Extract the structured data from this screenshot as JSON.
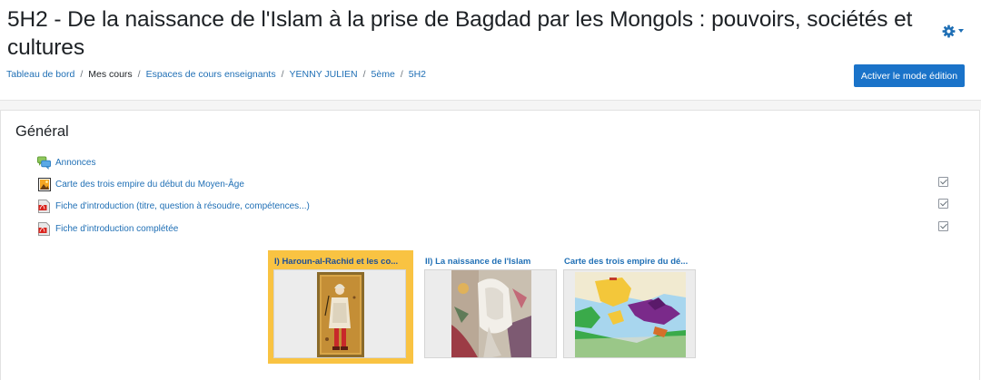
{
  "page": {
    "title": "5H2 - De la naissance de l'Islam à la prise de Bagdad par les Mongols : pouvoirs, sociétés et cultures",
    "accent_color": "#1a73c9",
    "highlight_color": "#f9c342"
  },
  "header_actions": {
    "settings_icon": "gear-icon",
    "edit_mode_label": "Activer le mode édition"
  },
  "breadcrumb": [
    {
      "label": "Tableau de bord"
    },
    {
      "label": "Mes cours"
    },
    {
      "label": "Espaces de cours enseignants"
    },
    {
      "label": "YENNY JULIEN"
    },
    {
      "label": "5ème"
    },
    {
      "label": "5H2"
    }
  ],
  "section": {
    "title": "Général",
    "activities": [
      {
        "label": "Annonces",
        "icon": "forum-icon",
        "completion": false
      },
      {
        "label": "Carte des trois empire du début du Moyen-Âge",
        "icon": "image-file-icon",
        "completion": true
      },
      {
        "label": "Fiche d'introduction (titre, question à résoudre, compétences...)",
        "icon": "pdf-file-icon",
        "completion": true
      },
      {
        "label": "Fiche d'introduction complétée",
        "icon": "pdf-file-icon",
        "completion": true
      }
    ]
  },
  "tiles": [
    {
      "label": "I) Haroun-al-Rachid et les co...",
      "thumbnail": "persian-miniature-thumbnail",
      "active": true
    },
    {
      "label": "II) La naissance de l'Islam",
      "thumbnail": "islamic-painting-thumbnail",
      "active": false
    },
    {
      "label": "Carte des trois empire du dé...",
      "thumbnail": "empires-map-thumbnail",
      "active": false
    }
  ]
}
